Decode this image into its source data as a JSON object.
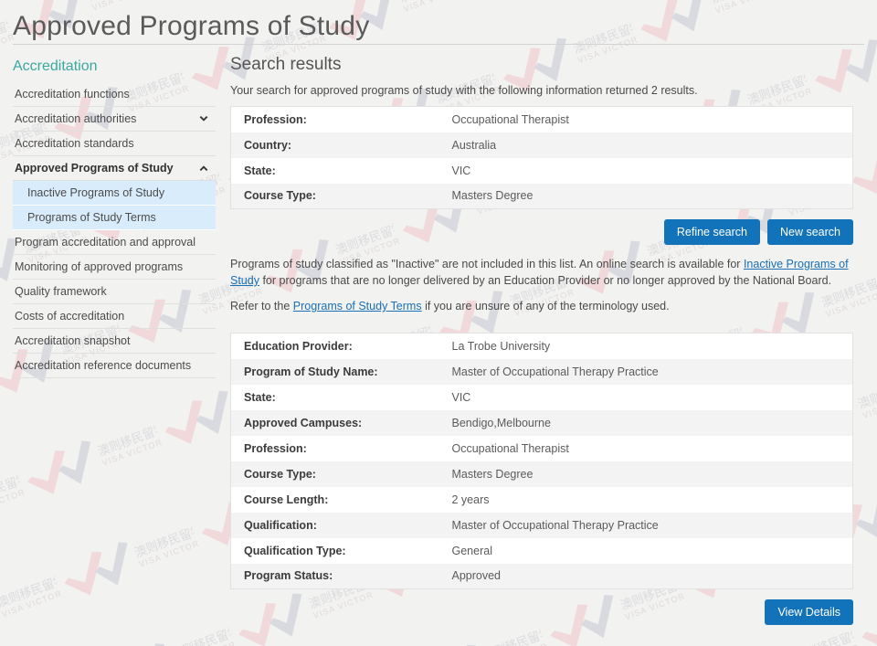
{
  "header": {
    "title": "Approved Programs of Study"
  },
  "sidebar": {
    "heading": "Accreditation",
    "items": [
      {
        "label": "Accreditation functions",
        "icon": "",
        "bold": false,
        "sub": false
      },
      {
        "label": "Accreditation authorities",
        "icon": "chevron-down-icon",
        "bold": false,
        "sub": false
      },
      {
        "label": "Accreditation standards",
        "icon": "",
        "bold": false,
        "sub": false
      },
      {
        "label": "Approved Programs of Study",
        "icon": "chevron-up-icon",
        "bold": true,
        "sub": false
      },
      {
        "label": "Inactive Programs of Study",
        "icon": "",
        "bold": false,
        "sub": true
      },
      {
        "label": "Programs of Study Terms",
        "icon": "",
        "bold": false,
        "sub": true
      },
      {
        "label": "Program accreditation and approval",
        "icon": "",
        "bold": false,
        "sub": false
      },
      {
        "label": "Monitoring of approved programs",
        "icon": "",
        "bold": false,
        "sub": false
      },
      {
        "label": "Quality framework",
        "icon": "",
        "bold": false,
        "sub": false
      },
      {
        "label": "Costs of accreditation",
        "icon": "",
        "bold": false,
        "sub": false
      },
      {
        "label": "Accreditation snapshot",
        "icon": "",
        "bold": false,
        "sub": false
      },
      {
        "label": "Accreditation reference documents",
        "icon": "",
        "bold": false,
        "sub": false
      }
    ]
  },
  "main": {
    "title": "Search results",
    "intro": "Your search for approved programs of study with the following information returned 2 results.",
    "criteria": [
      {
        "key": "Profession:",
        "value": "Occupational Therapist"
      },
      {
        "key": "Country:",
        "value": "Australia"
      },
      {
        "key": "State:",
        "value": "VIC"
      },
      {
        "key": "Course Type:",
        "value": "Masters Degree"
      }
    ],
    "buttons": {
      "refine": "Refine search",
      "new": "New search",
      "view_details": "View Details"
    },
    "note1": {
      "part1": "Programs of study classified as \"Inactive\" are not included in this list. An online search is available for ",
      "link": "Inactive Programs of Study",
      "part2": " for programs that are no longer delivered by an Education Provider or no longer approved by the National Board."
    },
    "note2": {
      "part1": "Refer to the ",
      "link": "Programs of Study Terms",
      "part2": " if you are unsure of any of the terminology used."
    },
    "result": [
      {
        "key": "Education Provider:",
        "value": "La Trobe University"
      },
      {
        "key": "Program of Study Name:",
        "value": "Master of Occupational Therapy Practice"
      },
      {
        "key": "State:",
        "value": "VIC"
      },
      {
        "key": "Approved Campuses:",
        "value": "Bendigo,Melbourne"
      },
      {
        "key": "Profession:",
        "value": "Occupational Therapist"
      },
      {
        "key": "Course Type:",
        "value": "Masters Degree"
      },
      {
        "key": "Course Length:",
        "value": "2 years"
      },
      {
        "key": "Qualification:",
        "value": "Master of Occupational Therapy Practice"
      },
      {
        "key": "Qualification Type:",
        "value": "General"
      },
      {
        "key": "Program Status:",
        "value": "Approved"
      }
    ]
  },
  "watermark": {
    "text_en": "VISA VICTORY",
    "text_cn": "澳则移民留学",
    "color_pink": "#f0c3c8",
    "color_grey": "#c3c6d2"
  },
  "colors": {
    "accent_blue": "#1373ba",
    "heading_teal": "#3aa8a0",
    "link_blue": "#1a6fb5",
    "submenu_bg": "#d9ecfb",
    "page_bg": "#f2f2f0"
  }
}
